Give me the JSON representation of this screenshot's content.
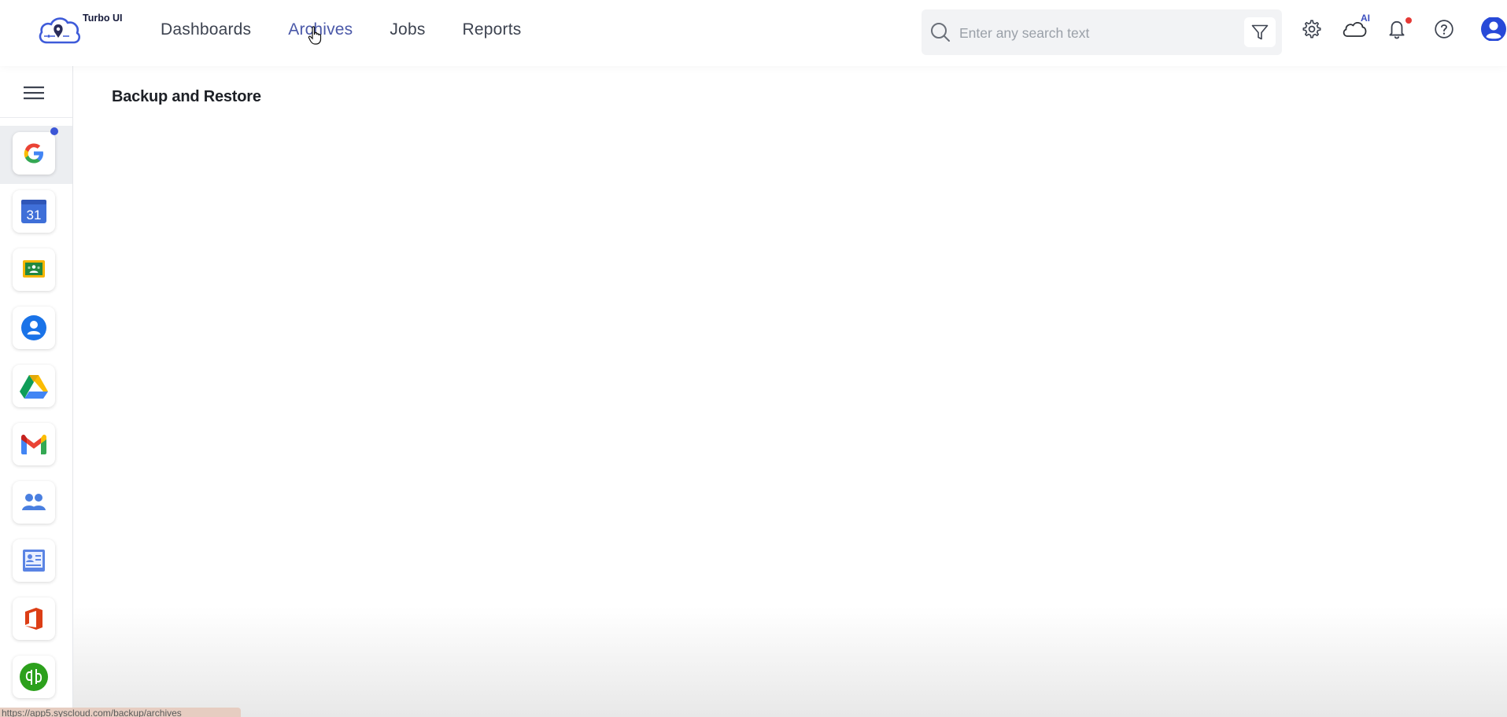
{
  "app": {
    "logo_text": "Turbo UI"
  },
  "nav": [
    {
      "label": "Dashboards",
      "active": false
    },
    {
      "label": "Archives",
      "active": true
    },
    {
      "label": "Jobs",
      "active": false
    },
    {
      "label": "Reports",
      "active": false
    }
  ],
  "search": {
    "placeholder": "Enter any search text",
    "value": ""
  },
  "header_icons": {
    "ai_badge": "AI",
    "notification_dot_color": "#e53935",
    "icons": [
      "filter-icon",
      "gear-icon",
      "ai-cloud-icon",
      "bell-icon",
      "help-icon",
      "user-avatar-icon"
    ]
  },
  "sidebar": {
    "apps": [
      {
        "name": "google",
        "icon": "google-g-icon",
        "active": true,
        "badge": true
      },
      {
        "name": "calendar",
        "icon": "calendar-icon",
        "text": "31"
      },
      {
        "name": "classroom",
        "icon": "classroom-icon"
      },
      {
        "name": "contacts",
        "icon": "contacts-icon"
      },
      {
        "name": "drive",
        "icon": "drive-icon"
      },
      {
        "name": "gmail",
        "icon": "gmail-icon"
      },
      {
        "name": "groups",
        "icon": "groups-icon"
      },
      {
        "name": "directory",
        "icon": "directory-icon"
      },
      {
        "name": "office",
        "icon": "office-icon"
      },
      {
        "name": "quickbooks",
        "icon": "quickbooks-icon"
      }
    ]
  },
  "main": {
    "title": "Backup and Restore"
  },
  "status_bar": {
    "url": "https://app5.syscloud.com/backup/archives"
  },
  "colors": {
    "accent": "#4a58a8",
    "badge_blue": "#3b56d6"
  }
}
